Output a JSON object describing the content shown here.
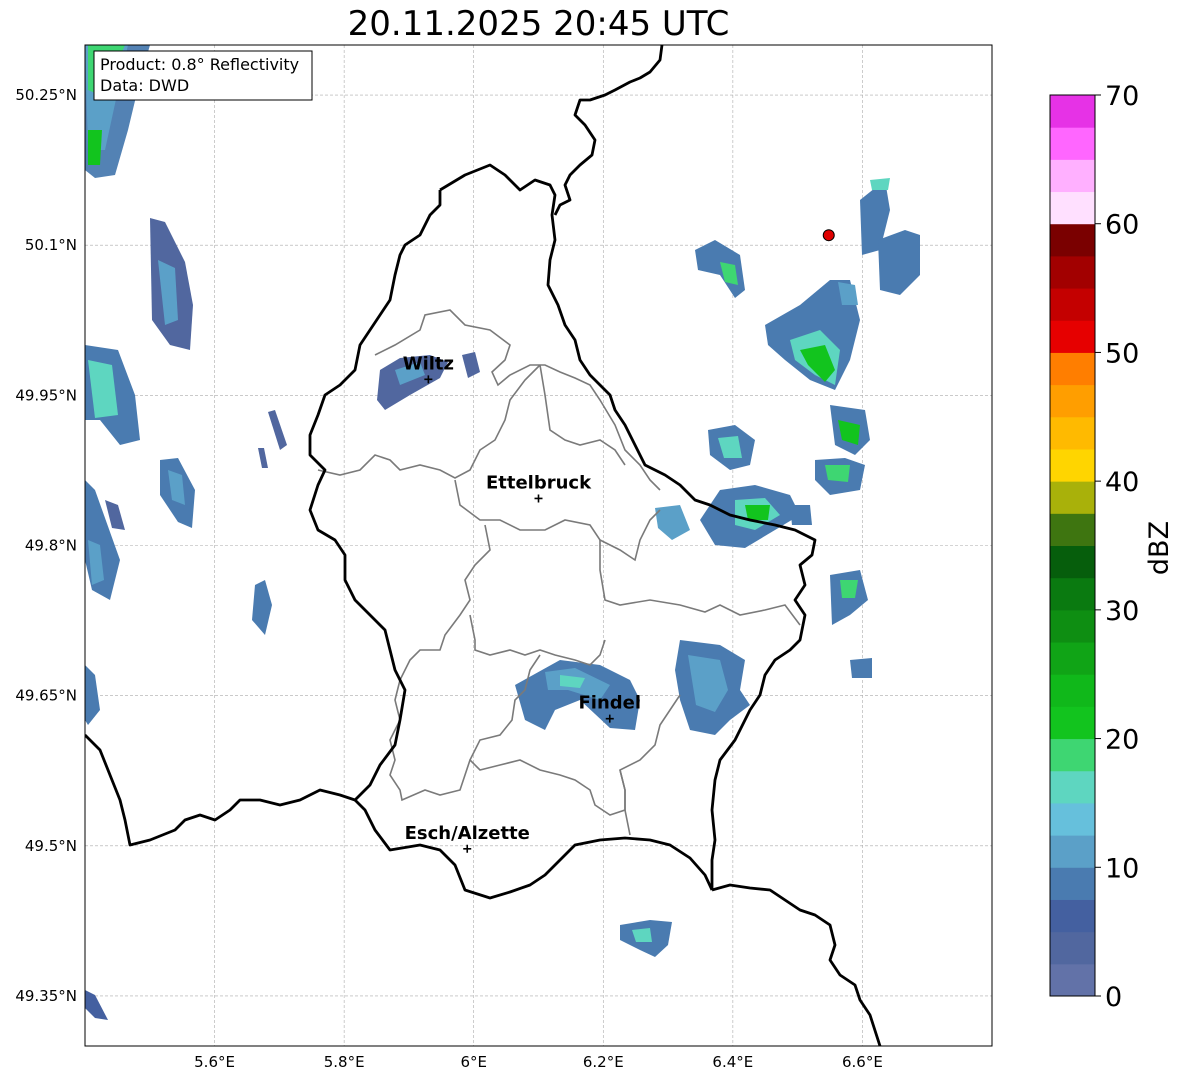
{
  "title": "20.11.2025 20:45 UTC",
  "info_box": {
    "product": "Product: 0.8° Reflectivity",
    "data": "Data: DWD"
  },
  "map": {
    "lon_range": [
      5.4,
      6.8
    ],
    "lat_range": [
      49.3,
      50.3
    ],
    "grid": true,
    "x_ticks": [
      {
        "value": 5.6,
        "label": "5.6°E"
      },
      {
        "value": 5.8,
        "label": "5.8°E"
      },
      {
        "value": 6.0,
        "label": "6°E"
      },
      {
        "value": 6.2,
        "label": "6.2°E"
      },
      {
        "value": 6.4,
        "label": "6.4°E"
      },
      {
        "value": 6.6,
        "label": "6.6°E"
      }
    ],
    "y_ticks": [
      {
        "value": 50.25,
        "label": "50.25°N"
      },
      {
        "value": 50.1,
        "label": "50.1°N"
      },
      {
        "value": 49.95,
        "label": "49.95°N"
      },
      {
        "value": 49.8,
        "label": "49.8°N"
      },
      {
        "value": 49.65,
        "label": "49.65°N"
      },
      {
        "value": 49.5,
        "label": "49.5°N"
      },
      {
        "value": 49.35,
        "label": "49.35°N"
      }
    ],
    "cities": [
      {
        "name": "Wiltz",
        "lon": 5.93,
        "lat": 49.966
      },
      {
        "name": "Ettelbruck",
        "lon": 6.1,
        "lat": 49.847
      },
      {
        "name": "Findel",
        "lon": 6.21,
        "lat": 49.627
      },
      {
        "name": "Esch/Alzette",
        "lon": 5.99,
        "lat": 49.497
      }
    ],
    "radar_site": {
      "lon": 6.548,
      "lat": 50.11,
      "color": "#e00000"
    }
  },
  "colorbar": {
    "label": "dBZ",
    "min": 0,
    "max": 70,
    "ticks": [
      0,
      10,
      20,
      30,
      40,
      50,
      60,
      70
    ],
    "colors": [
      "#6272a8",
      "#51679f",
      "#4460a0",
      "#4a7bb0",
      "#5ba0c8",
      "#66c0dc",
      "#5ed6c0",
      "#3ed672",
      "#12c41e",
      "#10b81a",
      "#10a416",
      "#0e8e12",
      "#0a7a10",
      "#065e0c",
      "#3e7510",
      "#a9b10a",
      "#ffd500",
      "#ffba00",
      "#ff9e00",
      "#ff7e00",
      "#e60000",
      "#c40000",
      "#a20000",
      "#7a0000",
      "#ffe0ff",
      "#ffb0ff",
      "#ff66ff",
      "#e632e6"
    ]
  }
}
